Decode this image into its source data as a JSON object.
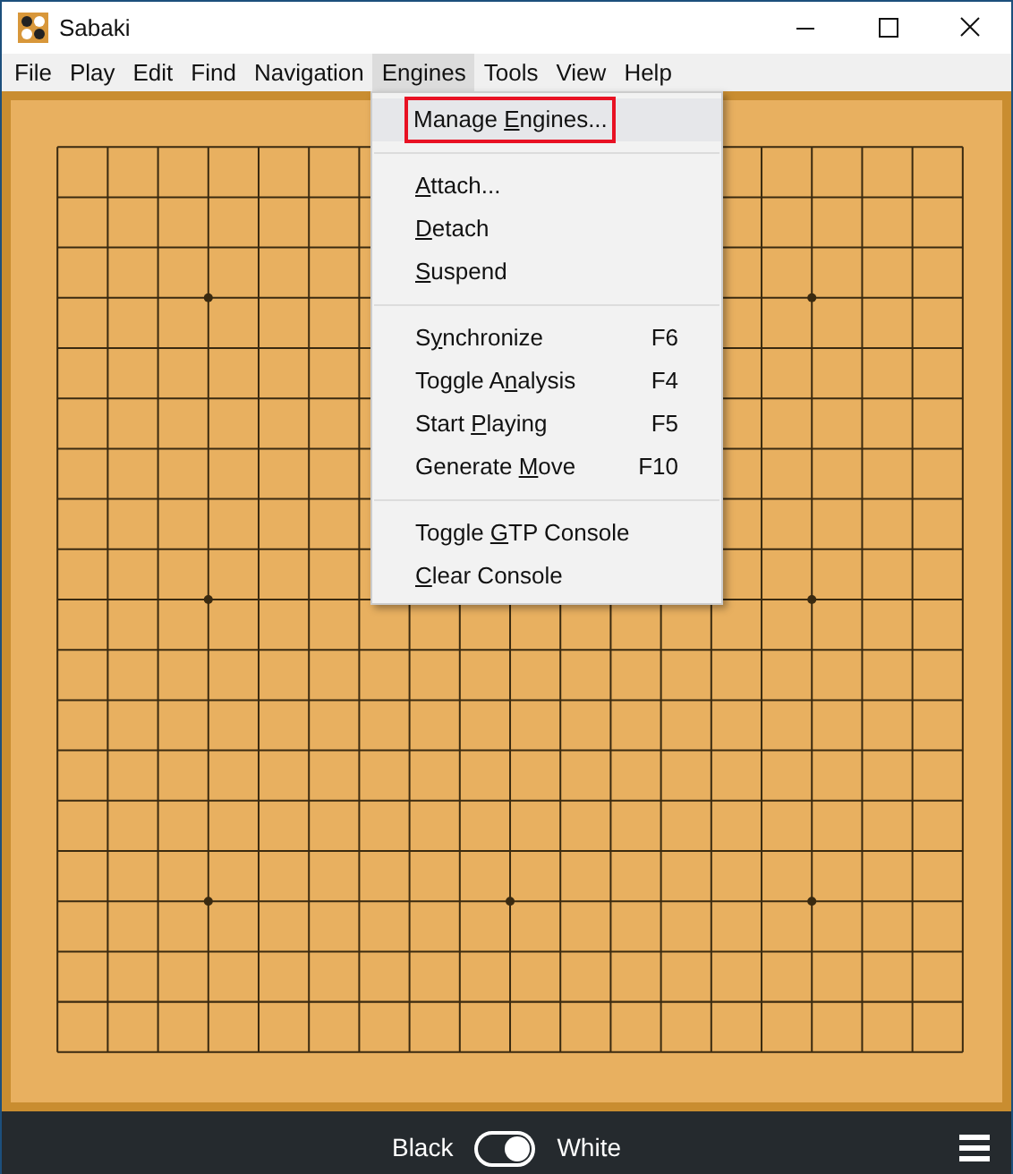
{
  "window": {
    "title": "Sabaki"
  },
  "menubar": [
    {
      "label": "File",
      "selected": false
    },
    {
      "label": "Play",
      "selected": false
    },
    {
      "label": "Edit",
      "selected": false
    },
    {
      "label": "Find",
      "selected": false
    },
    {
      "label": "Navigation",
      "selected": false
    },
    {
      "label": "Engines",
      "selected": true
    },
    {
      "label": "Tools",
      "selected": false
    },
    {
      "label": "View",
      "selected": false
    },
    {
      "label": "Help",
      "selected": false
    }
  ],
  "menu": {
    "groups": [
      [
        {
          "pre": "Manage ",
          "key": "E",
          "post": "ngines...",
          "selected": true,
          "outlined": true
        }
      ],
      [
        {
          "key": "A",
          "post": "ttach...",
          "selected": false,
          "outlined": false
        },
        {
          "key": "D",
          "post": "etach",
          "selected": false,
          "outlined": false
        },
        {
          "key": "S",
          "post": "uspend",
          "selected": false,
          "outlined": false
        }
      ],
      [
        {
          "pre": "S",
          "key": "y",
          "post": "nchronize",
          "shortcut": "F6",
          "selected": false,
          "outlined": false
        },
        {
          "pre": "Toggle A",
          "key": "n",
          "post": "alysis",
          "shortcut": "F4",
          "selected": false,
          "outlined": false
        },
        {
          "pre": "Start ",
          "key": "P",
          "post": "laying",
          "shortcut": "F5",
          "selected": false,
          "outlined": false
        },
        {
          "pre": "Generate ",
          "key": "M",
          "post": "ove",
          "shortcut": "F10",
          "selected": false,
          "outlined": false
        }
      ],
      [
        {
          "pre": "Toggle ",
          "key": "G",
          "post": "TP Console",
          "selected": false,
          "outlined": false
        },
        {
          "key": "C",
          "post": "lear Console",
          "selected": false,
          "outlined": false
        }
      ]
    ]
  },
  "bottom_bar": {
    "left_label": "Black",
    "right_label": "White",
    "toggle": {
      "on": true
    }
  }
}
